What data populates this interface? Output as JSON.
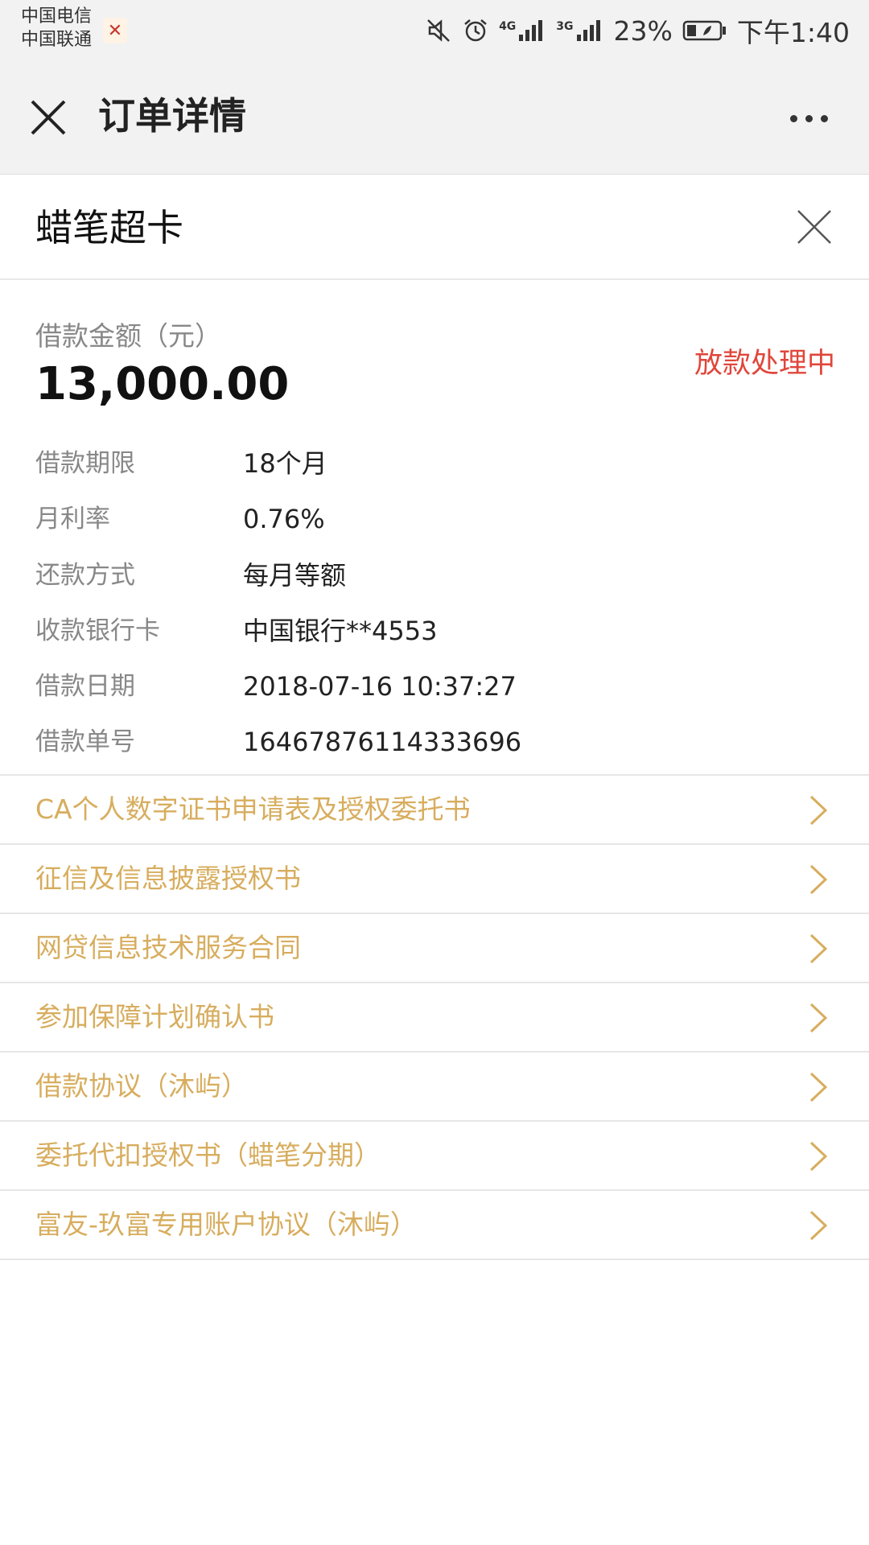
{
  "status_bar": {
    "carrier_1": "中国电信",
    "carrier_2": "中国联通",
    "battery": "23%",
    "time": "下午1:40",
    "signal_1_label": "4G",
    "signal_2_label": "3G",
    "icons": [
      "mute-icon",
      "alarm-icon",
      "signal-4g-icon",
      "signal-3g-icon",
      "battery-icon"
    ]
  },
  "header": {
    "title": "订单详情",
    "close_icon": "close-icon",
    "more_icon": "more-icon"
  },
  "product": {
    "name": "蜡笔超卡"
  },
  "loan": {
    "amount_label": "借款金额（元）",
    "amount": "13,000.00",
    "status": "放款处理中",
    "status_color": "#e0463a",
    "details": [
      {
        "label": "借款期限",
        "value": "18个月"
      },
      {
        "label": "月利率",
        "value": "0.76%"
      },
      {
        "label": "还款方式",
        "value": "每月等额"
      },
      {
        "label": "收款银行卡",
        "value": "中国银行**4553"
      },
      {
        "label": "借款日期",
        "value": "2018-07-16 10:37:27"
      },
      {
        "label": "借款单号",
        "value": "16467876114333696"
      }
    ]
  },
  "documents": [
    {
      "label": "CA个人数字证书申请表及授权委托书"
    },
    {
      "label": "征信及信息披露授权书"
    },
    {
      "label": "网贷信息技术服务合同"
    },
    {
      "label": "参加保障计划确认书"
    },
    {
      "label": "借款协议（沐屿）"
    },
    {
      "label": "委托代扣授权书（蜡笔分期）"
    },
    {
      "label": "富友-玖富专用账户协议（沐屿）"
    }
  ],
  "colors": {
    "link": "#d7ad5e",
    "status": "#e0463a",
    "header_bg": "#f2f2f2"
  }
}
